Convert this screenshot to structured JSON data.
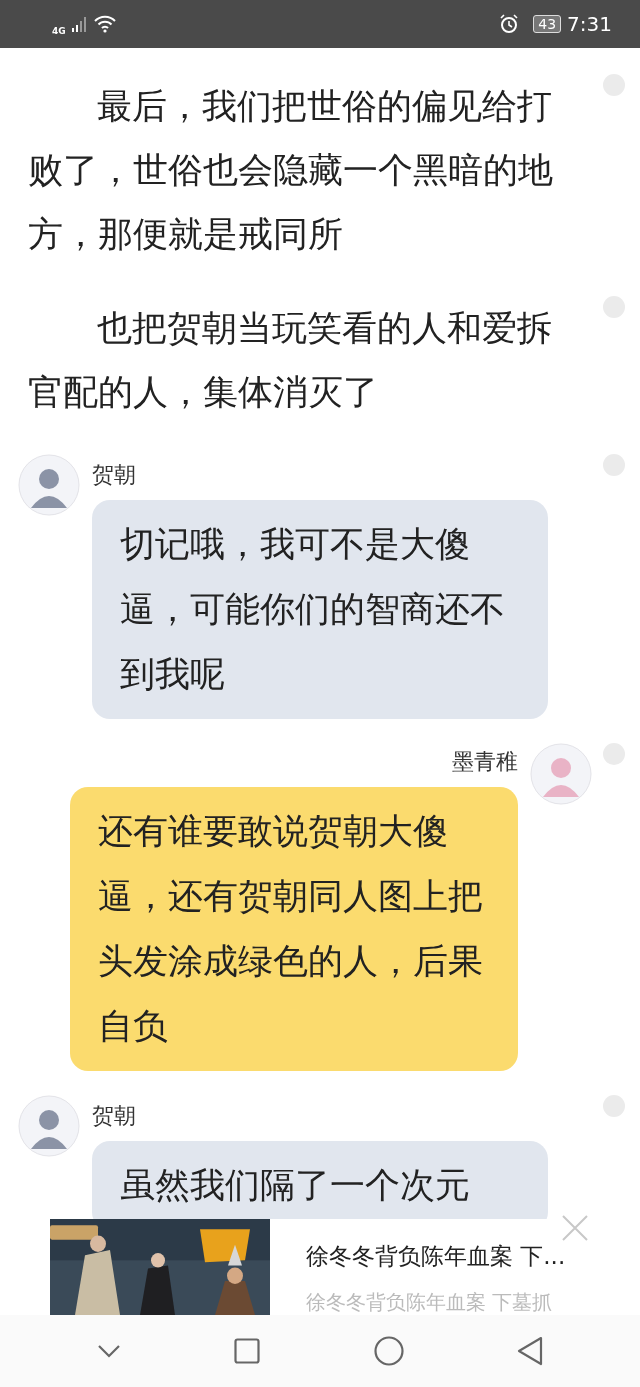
{
  "status_bar": {
    "network": "4G",
    "battery": "43",
    "time": "7:31"
  },
  "items": [
    {
      "kind": "paragraph",
      "text": "最后，我们把世俗的偏见给打败了，世俗也会隐藏一个黑暗的地方，那便就是戒同所"
    },
    {
      "kind": "paragraph",
      "text": "也把贺朝当玩笑看的人和爱拆官配的人，集体消灭了"
    },
    {
      "kind": "incoming",
      "name": "贺朝",
      "text": "切记哦，我可不是大傻逼，可能你们的智商还不到我呢"
    },
    {
      "kind": "outgoing",
      "name": "墨青稚",
      "text": "还有谁要敢说贺朝大傻逼，还有贺朝同人图上把头发涂成绿色的人，后果自负"
    },
    {
      "kind": "incoming",
      "name": "贺朝",
      "text": "虽然我们隔了一个次元"
    }
  ],
  "ad": {
    "title": "徐冬冬背负陈年血案 下...",
    "subtitle": "徐冬冬背负陈年血案 下墓抓"
  }
}
